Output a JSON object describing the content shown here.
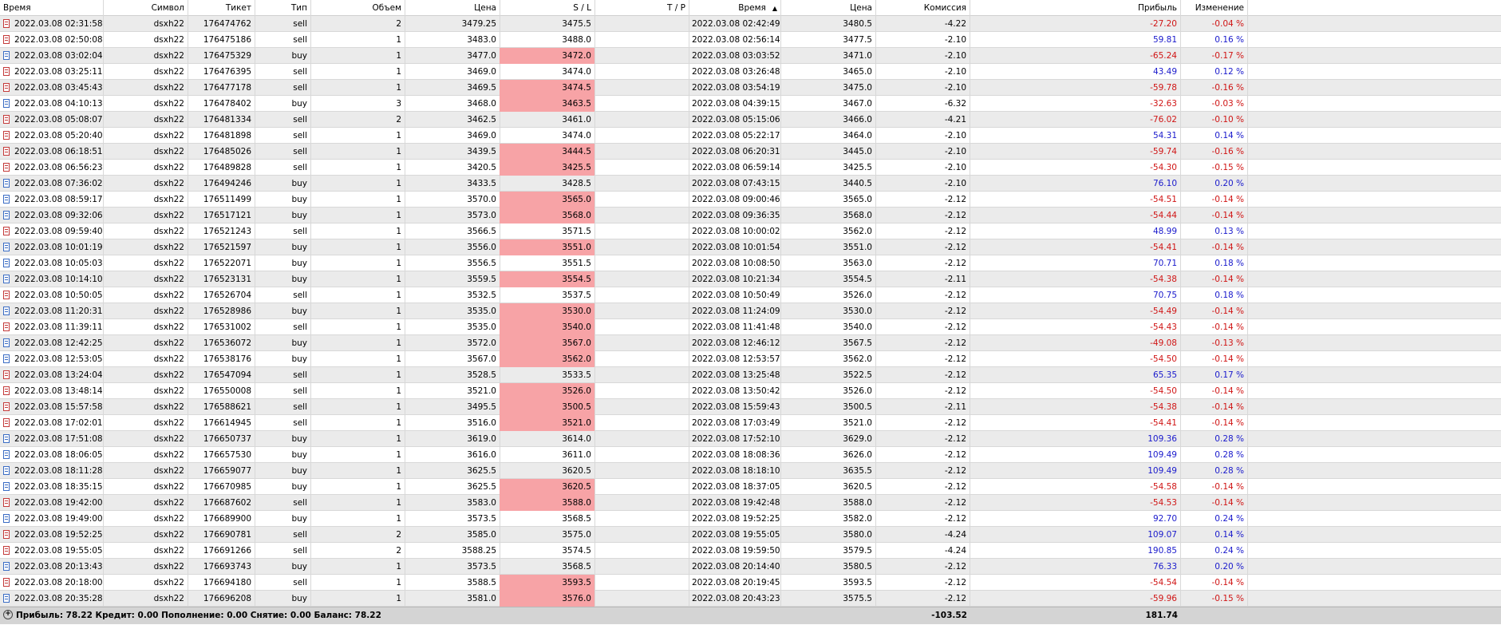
{
  "columns": [
    "Время",
    "Символ",
    "Тикет",
    "Тип",
    "Объем",
    "Цена",
    "S / L",
    "T / P",
    "Время",
    "Цена",
    "Комиссия",
    "Прибыль",
    "Изменение"
  ],
  "rows": [
    {
      "open": "2022.03.08 02:31:58",
      "sym": "dsxh22",
      "ticket": "176474762",
      "type": "sell",
      "vol": "2",
      "price": "3479.25",
      "sl": "3475.5",
      "hit": false,
      "close": "2022.03.08 02:42:49",
      "cprice": "3480.5",
      "comm": "-4.22",
      "profit": "-27.20",
      "change": "-0.04 %"
    },
    {
      "open": "2022.03.08 02:50:08",
      "sym": "dsxh22",
      "ticket": "176475186",
      "type": "sell",
      "vol": "1",
      "price": "3483.0",
      "sl": "3488.0",
      "hit": false,
      "close": "2022.03.08 02:56:14",
      "cprice": "3477.5",
      "comm": "-2.10",
      "profit": "59.81",
      "change": "0.16 %"
    },
    {
      "open": "2022.03.08 03:02:04",
      "sym": "dsxh22",
      "ticket": "176475329",
      "type": "buy",
      "vol": "1",
      "price": "3477.0",
      "sl": "3472.0",
      "hit": true,
      "close": "2022.03.08 03:03:52",
      "cprice": "3471.0",
      "comm": "-2.10",
      "profit": "-65.24",
      "change": "-0.17 %"
    },
    {
      "open": "2022.03.08 03:25:11",
      "sym": "dsxh22",
      "ticket": "176476395",
      "type": "sell",
      "vol": "1",
      "price": "3469.0",
      "sl": "3474.0",
      "hit": false,
      "close": "2022.03.08 03:26:48",
      "cprice": "3465.0",
      "comm": "-2.10",
      "profit": "43.49",
      "change": "0.12 %"
    },
    {
      "open": "2022.03.08 03:45:43",
      "sym": "dsxh22",
      "ticket": "176477178",
      "type": "sell",
      "vol": "1",
      "price": "3469.5",
      "sl": "3474.5",
      "hit": true,
      "close": "2022.03.08 03:54:19",
      "cprice": "3475.0",
      "comm": "-2.10",
      "profit": "-59.78",
      "change": "-0.16 %"
    },
    {
      "open": "2022.03.08 04:10:13",
      "sym": "dsxh22",
      "ticket": "176478402",
      "type": "buy",
      "vol": "3",
      "price": "3468.0",
      "sl": "3463.5",
      "hit": true,
      "close": "2022.03.08 04:39:15",
      "cprice": "3467.0",
      "comm": "-6.32",
      "profit": "-32.63",
      "change": "-0.03 %"
    },
    {
      "open": "2022.03.08 05:08:07",
      "sym": "dsxh22",
      "ticket": "176481334",
      "type": "sell",
      "vol": "2",
      "price": "3462.5",
      "sl": "3461.0",
      "hit": false,
      "close": "2022.03.08 05:15:06",
      "cprice": "3466.0",
      "comm": "-4.21",
      "profit": "-76.02",
      "change": "-0.10 %"
    },
    {
      "open": "2022.03.08 05:20:40",
      "sym": "dsxh22",
      "ticket": "176481898",
      "type": "sell",
      "vol": "1",
      "price": "3469.0",
      "sl": "3474.0",
      "hit": false,
      "close": "2022.03.08 05:22:17",
      "cprice": "3464.0",
      "comm": "-2.10",
      "profit": "54.31",
      "change": "0.14 %"
    },
    {
      "open": "2022.03.08 06:18:51",
      "sym": "dsxh22",
      "ticket": "176485026",
      "type": "sell",
      "vol": "1",
      "price": "3439.5",
      "sl": "3444.5",
      "hit": true,
      "close": "2022.03.08 06:20:31",
      "cprice": "3445.0",
      "comm": "-2.10",
      "profit": "-59.74",
      "change": "-0.16 %"
    },
    {
      "open": "2022.03.08 06:56:23",
      "sym": "dsxh22",
      "ticket": "176489828",
      "type": "sell",
      "vol": "1",
      "price": "3420.5",
      "sl": "3425.5",
      "hit": true,
      "close": "2022.03.08 06:59:14",
      "cprice": "3425.5",
      "comm": "-2.10",
      "profit": "-54.30",
      "change": "-0.15 %"
    },
    {
      "open": "2022.03.08 07:36:02",
      "sym": "dsxh22",
      "ticket": "176494246",
      "type": "buy",
      "vol": "1",
      "price": "3433.5",
      "sl": "3428.5",
      "hit": false,
      "close": "2022.03.08 07:43:15",
      "cprice": "3440.5",
      "comm": "-2.10",
      "profit": "76.10",
      "change": "0.20 %"
    },
    {
      "open": "2022.03.08 08:59:17",
      "sym": "dsxh22",
      "ticket": "176511499",
      "type": "buy",
      "vol": "1",
      "price": "3570.0",
      "sl": "3565.0",
      "hit": true,
      "close": "2022.03.08 09:00:46",
      "cprice": "3565.0",
      "comm": "-2.12",
      "profit": "-54.51",
      "change": "-0.14 %"
    },
    {
      "open": "2022.03.08 09:32:06",
      "sym": "dsxh22",
      "ticket": "176517121",
      "type": "buy",
      "vol": "1",
      "price": "3573.0",
      "sl": "3568.0",
      "hit": true,
      "close": "2022.03.08 09:36:35",
      "cprice": "3568.0",
      "comm": "-2.12",
      "profit": "-54.44",
      "change": "-0.14 %"
    },
    {
      "open": "2022.03.08 09:59:40",
      "sym": "dsxh22",
      "ticket": "176521243",
      "type": "sell",
      "vol": "1",
      "price": "3566.5",
      "sl": "3571.5",
      "hit": false,
      "close": "2022.03.08 10:00:02",
      "cprice": "3562.0",
      "comm": "-2.12",
      "profit": "48.99",
      "change": "0.13 %"
    },
    {
      "open": "2022.03.08 10:01:19",
      "sym": "dsxh22",
      "ticket": "176521597",
      "type": "buy",
      "vol": "1",
      "price": "3556.0",
      "sl": "3551.0",
      "hit": true,
      "close": "2022.03.08 10:01:54",
      "cprice": "3551.0",
      "comm": "-2.12",
      "profit": "-54.41",
      "change": "-0.14 %"
    },
    {
      "open": "2022.03.08 10:05:03",
      "sym": "dsxh22",
      "ticket": "176522071",
      "type": "buy",
      "vol": "1",
      "price": "3556.5",
      "sl": "3551.5",
      "hit": false,
      "close": "2022.03.08 10:08:50",
      "cprice": "3563.0",
      "comm": "-2.12",
      "profit": "70.71",
      "change": "0.18 %"
    },
    {
      "open": "2022.03.08 10:14:10",
      "sym": "dsxh22",
      "ticket": "176523131",
      "type": "buy",
      "vol": "1",
      "price": "3559.5",
      "sl": "3554.5",
      "hit": true,
      "close": "2022.03.08 10:21:34",
      "cprice": "3554.5",
      "comm": "-2.11",
      "profit": "-54.38",
      "change": "-0.14 %"
    },
    {
      "open": "2022.03.08 10:50:05",
      "sym": "dsxh22",
      "ticket": "176526704",
      "type": "sell",
      "vol": "1",
      "price": "3532.5",
      "sl": "3537.5",
      "hit": false,
      "close": "2022.03.08 10:50:49",
      "cprice": "3526.0",
      "comm": "-2.12",
      "profit": "70.75",
      "change": "0.18 %"
    },
    {
      "open": "2022.03.08 11:20:31",
      "sym": "dsxh22",
      "ticket": "176528986",
      "type": "buy",
      "vol": "1",
      "price": "3535.0",
      "sl": "3530.0",
      "hit": true,
      "close": "2022.03.08 11:24:09",
      "cprice": "3530.0",
      "comm": "-2.12",
      "profit": "-54.49",
      "change": "-0.14 %"
    },
    {
      "open": "2022.03.08 11:39:11",
      "sym": "dsxh22",
      "ticket": "176531002",
      "type": "sell",
      "vol": "1",
      "price": "3535.0",
      "sl": "3540.0",
      "hit": true,
      "close": "2022.03.08 11:41:48",
      "cprice": "3540.0",
      "comm": "-2.12",
      "profit": "-54.43",
      "change": "-0.14 %"
    },
    {
      "open": "2022.03.08 12:42:25",
      "sym": "dsxh22",
      "ticket": "176536072",
      "type": "buy",
      "vol": "1",
      "price": "3572.0",
      "sl": "3567.0",
      "hit": true,
      "close": "2022.03.08 12:46:12",
      "cprice": "3567.5",
      "comm": "-2.12",
      "profit": "-49.08",
      "change": "-0.13 %"
    },
    {
      "open": "2022.03.08 12:53:05",
      "sym": "dsxh22",
      "ticket": "176538176",
      "type": "buy",
      "vol": "1",
      "price": "3567.0",
      "sl": "3562.0",
      "hit": true,
      "close": "2022.03.08 12:53:57",
      "cprice": "3562.0",
      "comm": "-2.12",
      "profit": "-54.50",
      "change": "-0.14 %"
    },
    {
      "open": "2022.03.08 13:24:04",
      "sym": "dsxh22",
      "ticket": "176547094",
      "type": "sell",
      "vol": "1",
      "price": "3528.5",
      "sl": "3533.5",
      "hit": false,
      "close": "2022.03.08 13:25:48",
      "cprice": "3522.5",
      "comm": "-2.12",
      "profit": "65.35",
      "change": "0.17 %"
    },
    {
      "open": "2022.03.08 13:48:14",
      "sym": "dsxh22",
      "ticket": "176550008",
      "type": "sell",
      "vol": "1",
      "price": "3521.0",
      "sl": "3526.0",
      "hit": true,
      "close": "2022.03.08 13:50:42",
      "cprice": "3526.0",
      "comm": "-2.12",
      "profit": "-54.50",
      "change": "-0.14 %"
    },
    {
      "open": "2022.03.08 15:57:58",
      "sym": "dsxh22",
      "ticket": "176588621",
      "type": "sell",
      "vol": "1",
      "price": "3495.5",
      "sl": "3500.5",
      "hit": true,
      "close": "2022.03.08 15:59:43",
      "cprice": "3500.5",
      "comm": "-2.11",
      "profit": "-54.38",
      "change": "-0.14 %"
    },
    {
      "open": "2022.03.08 17:02:01",
      "sym": "dsxh22",
      "ticket": "176614945",
      "type": "sell",
      "vol": "1",
      "price": "3516.0",
      "sl": "3521.0",
      "hit": true,
      "close": "2022.03.08 17:03:49",
      "cprice": "3521.0",
      "comm": "-2.12",
      "profit": "-54.41",
      "change": "-0.14 %"
    },
    {
      "open": "2022.03.08 17:51:08",
      "sym": "dsxh22",
      "ticket": "176650737",
      "type": "buy",
      "vol": "1",
      "price": "3619.0",
      "sl": "3614.0",
      "hit": false,
      "close": "2022.03.08 17:52:10",
      "cprice": "3629.0",
      "comm": "-2.12",
      "profit": "109.36",
      "change": "0.28 %"
    },
    {
      "open": "2022.03.08 18:06:05",
      "sym": "dsxh22",
      "ticket": "176657530",
      "type": "buy",
      "vol": "1",
      "price": "3616.0",
      "sl": "3611.0",
      "hit": false,
      "close": "2022.03.08 18:08:36",
      "cprice": "3626.0",
      "comm": "-2.12",
      "profit": "109.49",
      "change": "0.28 %"
    },
    {
      "open": "2022.03.08 18:11:28",
      "sym": "dsxh22",
      "ticket": "176659077",
      "type": "buy",
      "vol": "1",
      "price": "3625.5",
      "sl": "3620.5",
      "hit": false,
      "close": "2022.03.08 18:18:10",
      "cprice": "3635.5",
      "comm": "-2.12",
      "profit": "109.49",
      "change": "0.28 %"
    },
    {
      "open": "2022.03.08 18:35:15",
      "sym": "dsxh22",
      "ticket": "176670985",
      "type": "buy",
      "vol": "1",
      "price": "3625.5",
      "sl": "3620.5",
      "hit": true,
      "close": "2022.03.08 18:37:05",
      "cprice": "3620.5",
      "comm": "-2.12",
      "profit": "-54.58",
      "change": "-0.14 %"
    },
    {
      "open": "2022.03.08 19:42:00",
      "sym": "dsxh22",
      "ticket": "176687602",
      "type": "sell",
      "vol": "1",
      "price": "3583.0",
      "sl": "3588.0",
      "hit": true,
      "close": "2022.03.08 19:42:48",
      "cprice": "3588.0",
      "comm": "-2.12",
      "profit": "-54.53",
      "change": "-0.14 %"
    },
    {
      "open": "2022.03.08 19:49:00",
      "sym": "dsxh22",
      "ticket": "176689900",
      "type": "buy",
      "vol": "1",
      "price": "3573.5",
      "sl": "3568.5",
      "hit": false,
      "close": "2022.03.08 19:52:25",
      "cprice": "3582.0",
      "comm": "-2.12",
      "profit": "92.70",
      "change": "0.24 %"
    },
    {
      "open": "2022.03.08 19:52:25",
      "sym": "dsxh22",
      "ticket": "176690781",
      "type": "sell",
      "vol": "2",
      "price": "3585.0",
      "sl": "3575.0",
      "hit": false,
      "close": "2022.03.08 19:55:05",
      "cprice": "3580.0",
      "comm": "-4.24",
      "profit": "109.07",
      "change": "0.14 %"
    },
    {
      "open": "2022.03.08 19:55:05",
      "sym": "dsxh22",
      "ticket": "176691266",
      "type": "sell",
      "vol": "2",
      "price": "3588.25",
      "sl": "3574.5",
      "hit": false,
      "close": "2022.03.08 19:59:50",
      "cprice": "3579.5",
      "comm": "-4.24",
      "profit": "190.85",
      "change": "0.24 %"
    },
    {
      "open": "2022.03.08 20:13:43",
      "sym": "dsxh22",
      "ticket": "176693743",
      "type": "buy",
      "vol": "1",
      "price": "3573.5",
      "sl": "3568.5",
      "hit": false,
      "close": "2022.03.08 20:14:40",
      "cprice": "3580.5",
      "comm": "-2.12",
      "profit": "76.33",
      "change": "0.20 %"
    },
    {
      "open": "2022.03.08 20:18:00",
      "sym": "dsxh22",
      "ticket": "176694180",
      "type": "sell",
      "vol": "1",
      "price": "3588.5",
      "sl": "3593.5",
      "hit": true,
      "close": "2022.03.08 20:19:45",
      "cprice": "3593.5",
      "comm": "-2.12",
      "profit": "-54.54",
      "change": "-0.14 %"
    },
    {
      "open": "2022.03.08 20:35:28",
      "sym": "dsxh22",
      "ticket": "176696208",
      "type": "buy",
      "vol": "1",
      "price": "3581.0",
      "sl": "3576.0",
      "hit": true,
      "close": "2022.03.08 20:43:23",
      "cprice": "3575.5",
      "comm": "-2.12",
      "profit": "-59.96",
      "change": "-0.15 %"
    }
  ],
  "footer": {
    "summary": "Прибыль: 78.22  Кредит: 0.00  Пополнение: 0.00  Снятие: 0.00  Баланс: 78.22",
    "commission_total": "-103.52",
    "profit_total": "181.74"
  },
  "colors": {
    "sl_hit_bg": "#f7a3a6",
    "positive": "#1a1acc",
    "negative": "#d01515",
    "alt_row": "#ebebeb"
  }
}
